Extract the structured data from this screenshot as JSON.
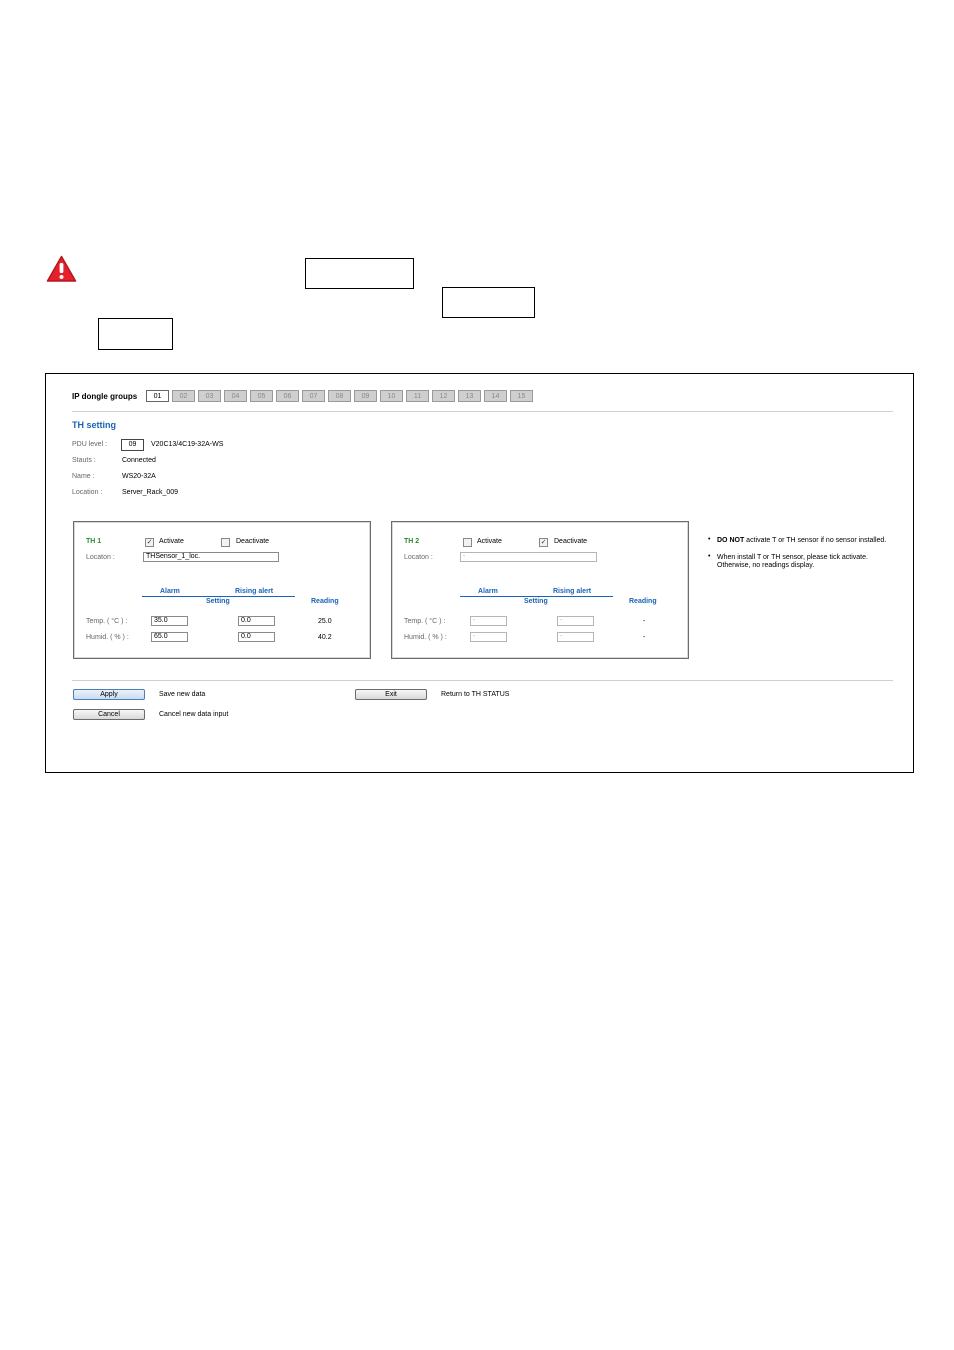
{
  "ui": {
    "groups_label": "IP dongle groups",
    "groups": [
      "01",
      "02",
      "03",
      "04",
      "05",
      "06",
      "07",
      "08",
      "09",
      "10",
      "11",
      "12",
      "13",
      "14",
      "15"
    ],
    "active_group": "01",
    "title": "TH setting",
    "info": {
      "pdu_label": "PDU level :",
      "pdu_level": "09",
      "pdu_model": "V20C13/4C19-32A-WS",
      "status_label": "Stauts :",
      "status_value": "Connected",
      "name_label": "Name :",
      "name_value": "WS20-32A",
      "location_label": "Location :",
      "location_value": "Server_Rack_009"
    },
    "sensors": [
      {
        "title": "TH 1",
        "activate_label": "Activate",
        "deactivate_label": "Deactivate",
        "activate_checked": true,
        "deactivate_checked": false,
        "location_label": "Locaton :",
        "location_value": "THSensor_1_loc.",
        "alarm_header": "Alarm",
        "rising_header": "Rising alert",
        "setting_header": "Setting",
        "reading_header": "Reading",
        "temp_label": "Temp. ( °C ) :",
        "humid_label": "Humid. ( % ) :",
        "temp_alarm": "35.0",
        "temp_rising": "0.0",
        "temp_reading": "25.0",
        "humid_alarm": "65.0",
        "humid_rising": "0.0",
        "humid_reading": "40.2"
      },
      {
        "title": "TH 2",
        "activate_label": "Activate",
        "deactivate_label": "Deactivate",
        "activate_checked": false,
        "deactivate_checked": true,
        "location_label": "Locaton :",
        "location_value": "-",
        "alarm_header": "Alarm",
        "rising_header": "Rising alert",
        "setting_header": "Setting",
        "reading_header": "Reading",
        "temp_label": "Temp. ( °C ) :",
        "humid_label": "Humid. ( % ) :",
        "temp_alarm": "-",
        "temp_rising": "-",
        "temp_reading": "-",
        "humid_alarm": "-",
        "humid_rising": "-",
        "humid_reading": "-"
      }
    ],
    "notes": {
      "note1_bold": "DO NOT",
      "note1_rest": " activate T or TH sensor if no sensor installed.",
      "note2_line1": "When install T or TH sensor, please tick activate.",
      "note2_line2": "Otherwise, no readings display."
    },
    "buttons": {
      "apply_label": "Apply",
      "apply_desc": "Save new data",
      "cancel_label": "Cancel",
      "cancel_desc": "Cancel new data input",
      "exit_label": "Exit",
      "exit_desc": "Return to TH STATUS"
    }
  }
}
